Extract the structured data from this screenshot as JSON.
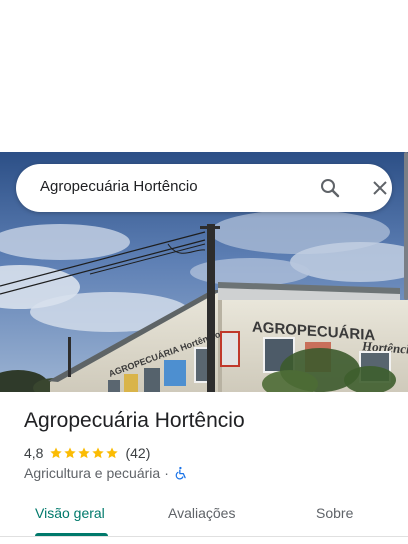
{
  "search": {
    "query": "Agropecuária Hortêncio"
  },
  "place": {
    "name": "Agropecuária Hortêncio",
    "rating": "4,8",
    "stars": 5,
    "review_count": "(42)",
    "category": "Agricultura e pecuária",
    "separator": "·",
    "sign_text": "AGROPECUÁRIA Hortêncio",
    "sign_text_small": "AGROPECUÁRIA Hortêncio"
  },
  "tabs": [
    {
      "label": "Visão geral",
      "active": true
    },
    {
      "label": "Avaliações",
      "active": false
    },
    {
      "label": "Sobre",
      "active": false
    }
  ],
  "colors": {
    "accent": "#00796b",
    "star": "#fbbc04",
    "accessibility": "#1a73e8"
  },
  "icons": [
    "search-icon",
    "close-icon",
    "star-icon",
    "wheelchair-icon"
  ]
}
